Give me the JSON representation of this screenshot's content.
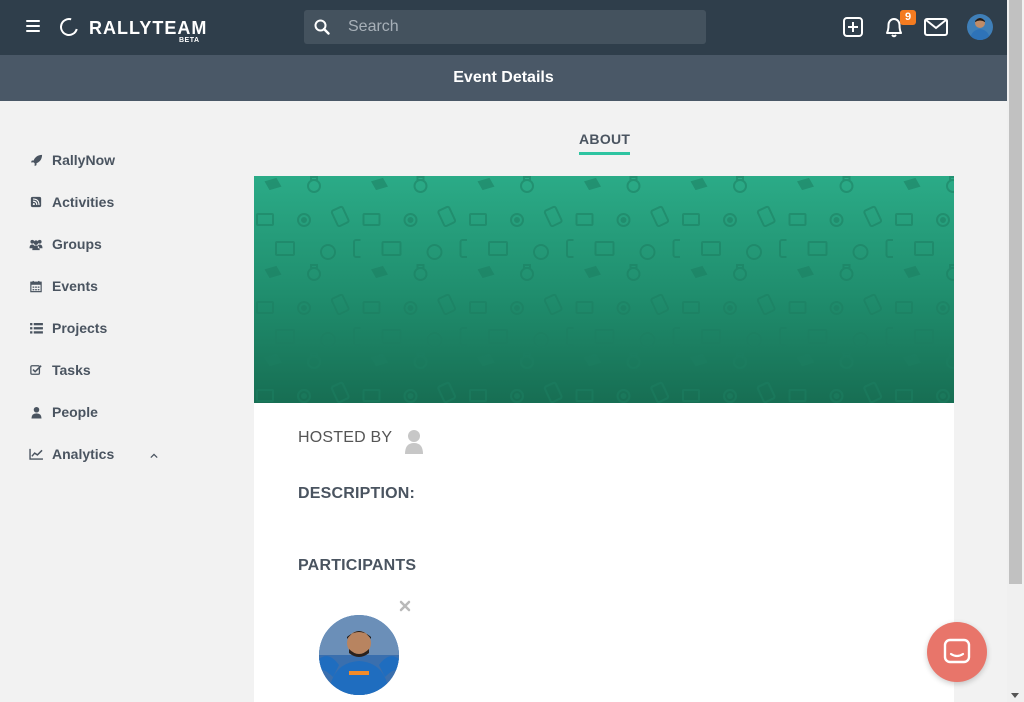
{
  "app": {
    "logo_text": "RALLYTEAM",
    "logo_badge": "BETA"
  },
  "search": {
    "placeholder": "Search",
    "value": ""
  },
  "notifications": {
    "count": "9"
  },
  "header": {
    "title": "Event Details"
  },
  "sidebar": {
    "items": [
      {
        "label": "RallyNow",
        "icon": "rocket-icon"
      },
      {
        "label": "Activities",
        "icon": "rss-icon"
      },
      {
        "label": "Groups",
        "icon": "users-icon"
      },
      {
        "label": "Events",
        "icon": "calendar-icon"
      },
      {
        "label": "Projects",
        "icon": "list-icon"
      },
      {
        "label": "Tasks",
        "icon": "checkbox-icon"
      },
      {
        "label": "People",
        "icon": "user-icon"
      },
      {
        "label": "Analytics",
        "icon": "line-chart-icon"
      }
    ]
  },
  "main": {
    "tab_about": "ABOUT",
    "hosted_by": "HOSTED BY",
    "description_label": "DESCRIPTION:",
    "participants_label": "PARTICIPANTS"
  },
  "colors": {
    "navbar": "#2f3e4b",
    "subheader": "#4a5867",
    "accent": "#2ec4a1",
    "badge": "#f47b20",
    "chat_button": "#e8756a"
  }
}
